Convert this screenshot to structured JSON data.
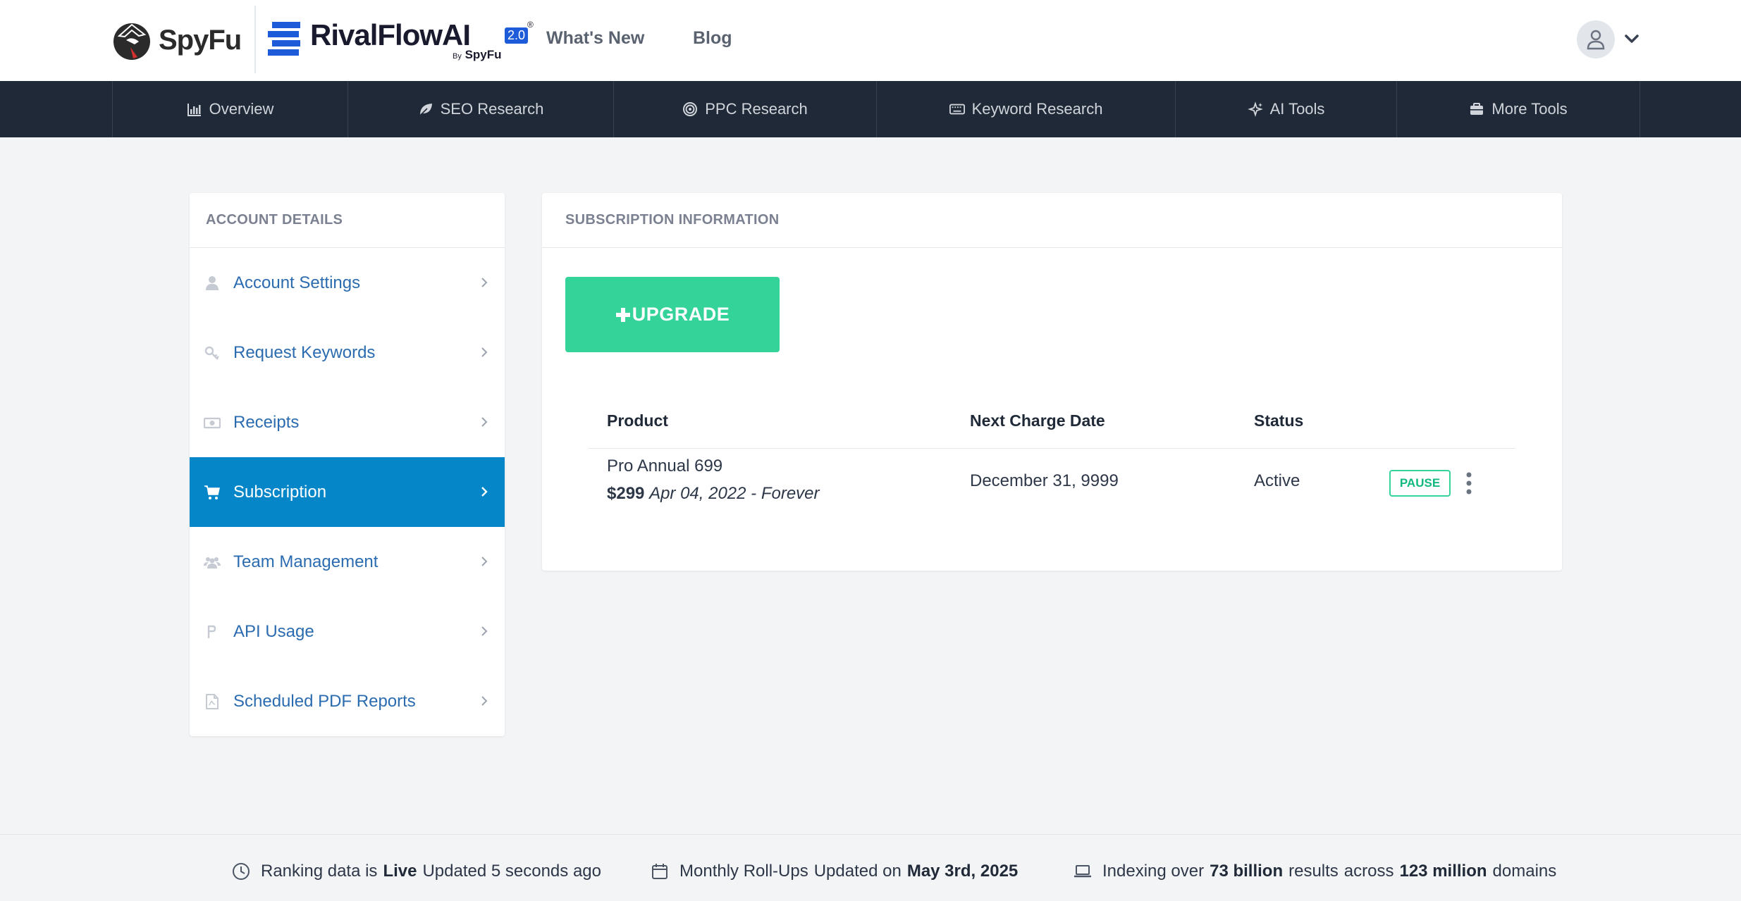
{
  "header": {
    "spyfu_brand": "SpyFu",
    "rival_brand": "RivalFlowAI",
    "rival_version": "2.0",
    "rival_registered": "®",
    "rival_by_prefix": "By",
    "rival_by_brand": "SpyFu",
    "links": [
      "What's New",
      "Blog"
    ]
  },
  "nav": {
    "items": [
      {
        "label": "Overview",
        "icon": "bar-chart-icon"
      },
      {
        "label": "SEO Research",
        "icon": "leaf-icon"
      },
      {
        "label": "PPC Research",
        "icon": "target-icon"
      },
      {
        "label": "Keyword Research",
        "icon": "keyboard-icon"
      },
      {
        "label": "AI Tools",
        "icon": "sparkle-icon"
      },
      {
        "label": "More Tools",
        "icon": "briefcase-icon"
      }
    ]
  },
  "sidebar": {
    "title": "ACCOUNT DETAILS",
    "items": [
      {
        "label": "Account Settings",
        "icon": "user-icon"
      },
      {
        "label": "Request Keywords",
        "icon": "key-icon"
      },
      {
        "label": "Receipts",
        "icon": "money-icon"
      },
      {
        "label": "Subscription",
        "icon": "cart-icon",
        "active": true
      },
      {
        "label": "Team Management",
        "icon": "users-icon"
      },
      {
        "label": "API Usage",
        "icon": "api-icon"
      },
      {
        "label": "Scheduled PDF Reports",
        "icon": "pdf-icon"
      }
    ]
  },
  "main": {
    "title": "SUBSCRIPTION INFORMATION",
    "upgrade_label": "UPGRADE",
    "table": {
      "headers": [
        "Product",
        "Next Charge Date",
        "Status"
      ],
      "rows": [
        {
          "product": "Pro Annual 699",
          "price": "$299",
          "period": "Apr 04, 2022 - Forever",
          "next_charge": "December 31, 9999",
          "status": "Active",
          "action": "PAUSE"
        }
      ]
    }
  },
  "footer": {
    "ranking": {
      "prefix": "Ranking data is",
      "bold": "Live",
      "suffix": "Updated 5 seconds ago"
    },
    "rollups": {
      "prefix": "Monthly Roll-Ups",
      "middle": "Updated on",
      "bold": "May 3rd, 2025"
    },
    "indexing": {
      "prefix": "Indexing over",
      "bold1": "73 billion",
      "middle1": "results",
      "middle2": "across",
      "bold2": "123 million",
      "suffix": "domains"
    }
  },
  "colors": {
    "nav_bg": "#1f2937",
    "active_bg": "#0586c9",
    "upgrade_bg": "#34d399",
    "link_blue": "#2b6cb0"
  }
}
